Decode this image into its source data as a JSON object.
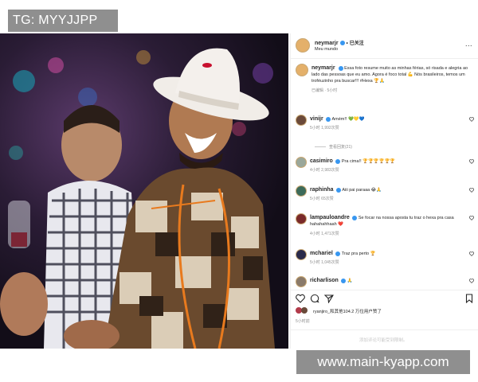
{
  "watermark_tag": "TG: MYYJJPP",
  "site_watermark": "www.main-kyapp.com",
  "post": {
    "username": "neymarjr",
    "follow_label": "已关注",
    "location": "Meu mundo",
    "more_label": "...",
    "caption": "Essa foto resume muito as minhas férias, só risada e alegria ao lado das pessoas que eu amo. Agora é foco total 💪 Nós brasileiros, temos um troféuzinho pra buscar!!! #Hexa 🏆🙏",
    "caption_time": "已编辑 · 5小时"
  },
  "comments": [
    {
      "user": "vinijr",
      "text": "Amém!! 💚💛💙",
      "meta": "5小时  1,992次赞",
      "replies": "查看回复(21)",
      "avatar_color": "#6b4a3a"
    },
    {
      "user": "casimiro",
      "text": "Pra cima!! 🏆🏆🏆🏆🏆🏆",
      "meta": "4小时  2,983次赞",
      "replies": "",
      "avatar_color": "#9aa79a"
    },
    {
      "user": "raphinha",
      "text": "Aiii pai paraaa 😂🙏",
      "meta": "5小时  65次赞",
      "replies": "",
      "avatar_color": "#3d6b5a"
    },
    {
      "user": "lampauloandre",
      "text": "Se focar na nossa aposta tu traz o hexa pra casa hahahahhaah ❤️",
      "meta": "4小时  1,471次赞",
      "replies": "",
      "avatar_color": "#7a2a2a"
    },
    {
      "user": "mchariel",
      "text": "Traz pra perto 🏆",
      "meta": "5小时  1,045次赞",
      "replies": "",
      "avatar_color": "#2a2a4a"
    },
    {
      "user": "richarlison",
      "text": "🙏",
      "meta": "",
      "replies": "",
      "avatar_color": "#8a7a6a"
    }
  ],
  "likes_text": "ryanjiro_和其他104.2 万位用户赞了",
  "post_time": "5小时前",
  "add_comment_placeholder": "添加评论可能受到限制。"
}
